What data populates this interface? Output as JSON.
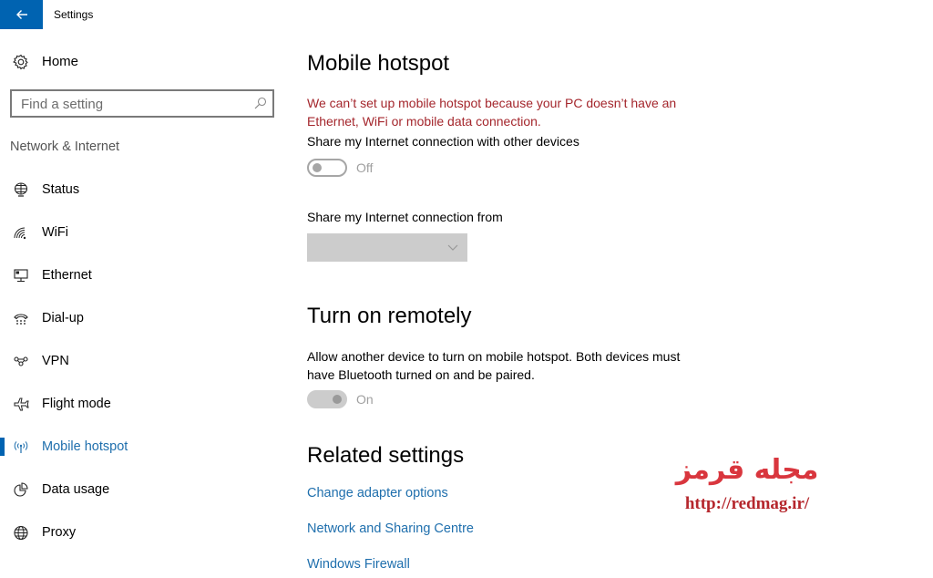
{
  "window": {
    "title": "Settings",
    "back_icon": "arrow-left-icon",
    "accent_color": "#0063b1"
  },
  "sidebar": {
    "home": {
      "label": "Home",
      "icon": "gear-icon"
    },
    "search": {
      "placeholder": "Find a setting",
      "value": "",
      "icon": "search-icon"
    },
    "section_label": "Network & Internet",
    "items": [
      {
        "label": "Status",
        "icon": "globe-status-icon",
        "active": false
      },
      {
        "label": "WiFi",
        "icon": "wifi-icon",
        "active": false
      },
      {
        "label": "Ethernet",
        "icon": "ethernet-icon",
        "active": false
      },
      {
        "label": "Dial-up",
        "icon": "dialup-phone-icon",
        "active": false
      },
      {
        "label": "VPN",
        "icon": "vpn-icon",
        "active": false
      },
      {
        "label": "Flight mode",
        "icon": "airplane-icon",
        "active": false
      },
      {
        "label": "Mobile hotspot",
        "icon": "hotspot-icon",
        "active": true
      },
      {
        "label": "Data usage",
        "icon": "pie-chart-icon",
        "active": false
      },
      {
        "label": "Proxy",
        "icon": "globe-icon",
        "active": false
      }
    ]
  },
  "main": {
    "title": "Mobile hotspot",
    "error_message": "We can’t set up mobile hotspot because your PC doesn’t have an Ethernet, WiFi or mobile data connection.",
    "share_label": "Share my Internet connection with other devices",
    "share_toggle": {
      "state": "Off",
      "enabled": false
    },
    "share_from_label": "Share my Internet connection from",
    "share_from_dropdown": {
      "selected": "",
      "enabled": false
    },
    "remote": {
      "title": "Turn on remotely",
      "description": "Allow another device to turn on mobile hotspot. Both devices must have Bluetooth turned on and be paired.",
      "toggle": {
        "state": "On",
        "enabled": false
      }
    },
    "related": {
      "title": "Related settings",
      "links": [
        "Change adapter options",
        "Network and Sharing Centre",
        "Windows Firewall"
      ]
    },
    "error_color": "#a4262c",
    "link_color": "#1f6fad"
  },
  "watermark": {
    "text": "مجله قرمز",
    "url": "http://redmag.ir/"
  }
}
